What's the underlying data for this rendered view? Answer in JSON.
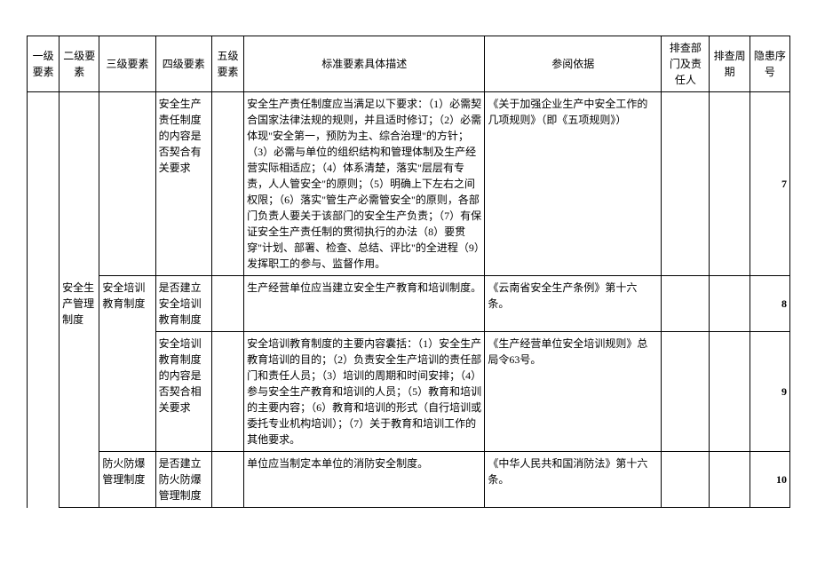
{
  "headers": {
    "c1": "一级要素",
    "c2": "二级要素",
    "c3": "三级要素",
    "c4": "四级要素",
    "c5": "五级要素",
    "c6": "标准要素具体描述",
    "c7": "参阅依据",
    "c8": "排查部门及责任人",
    "c9": "排查周期",
    "c10": "隐患序号"
  },
  "rows": [
    {
      "c2": "",
      "c3": "",
      "c4": "安全生产责任制度的内容是否契合有关要求",
      "c6": "安全生产责任制度应当满足以下要求：（1）必需契合国家法律法规的规则，并且适时修订；（2）必需体现\"安全第一，预防为主、综合治理\"的方针；（3）必需与单位的组织结构和管理体制及生产经营实际相适应；（4）体系清楚，落实\"层层有专责，人人管安全\"的原则；（5）明确上下左右之间权限；（6）落实\"管生产必需管安全\"的原则，各部门负责人要关于该部门的安全生产负责；（7）有保证安全生产责任制的贯彻执行的办法（8）要贯穿\"计划、部署、检查、总结、评比\"的全进程（9）发挥职工的参与、监督作用。",
      "c7": "《关于加强企业生产中安全工作的几项规则》（即《五项规则》）",
      "c10": "7"
    },
    {
      "c2": "安全生产管理制度",
      "c3": "安全培训教育制度",
      "c4": "是否建立安全培训教育制度",
      "c6": "生产经营单位应当建立安全生产教育和培训制度。",
      "c7": "《云南省安全生产条例》第十六条。",
      "c10": "8"
    },
    {
      "c3": "",
      "c4": "安全培训教育制度的内容是否契合相关要求",
      "c6": "安全培训教育制度的主要内容囊括：（1）安全生产教育培训的目的；（2）负责安全生产培训的责任部门和责任人员；（3）培训的周期和时间安排；（4）参与安全生产教育和培训的人员；（5）教育和培训的主要内容；（6）教育和培训的形式（自行培训或委托专业机构培训）；（7）关于教育和培训工作的其他要求。",
      "c7": "《生产经营单位安全培训规则》总局令63号。",
      "c10": "9"
    },
    {
      "c3": "防火防爆管理制度",
      "c4": "是否建立防火防爆管理制度",
      "c6": "单位应当制定本单位的消防安全制度。",
      "c7": "《中华人民共和国消防法》第十六条。",
      "c10": "10"
    }
  ]
}
